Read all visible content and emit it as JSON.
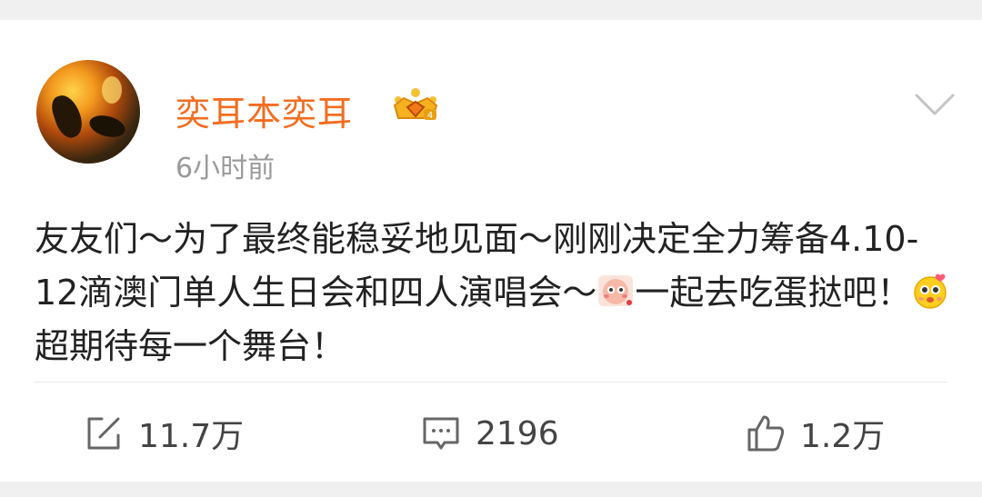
{
  "post": {
    "author": "奕耳本奕耳",
    "badge_icon": "vip-crown-badge",
    "time": "6小时前",
    "menu_icon": "chevron-down-icon",
    "text_part1": "友友们～为了最终能稳妥地见面～刚刚决定全力筹备4.10-12滴澳门单人生日会和四人演唱会～",
    "emoji1": "shy-emoji",
    "text_part2": "一起去吃蛋挞吧！",
    "emoji2": "love-eyes-emoji",
    "text_part3": "超期待每一个舞台！"
  },
  "actions": {
    "repost": {
      "icon": "share-icon",
      "count": "11.7万"
    },
    "comment": {
      "icon": "comment-icon",
      "count": "2196"
    },
    "like": {
      "icon": "thumbs-up-icon",
      "count": "1.2万"
    }
  },
  "colors": {
    "author_name": "#f26d21",
    "text": "#222222",
    "muted": "#9a9a9a",
    "background": "#f0f0f0"
  }
}
